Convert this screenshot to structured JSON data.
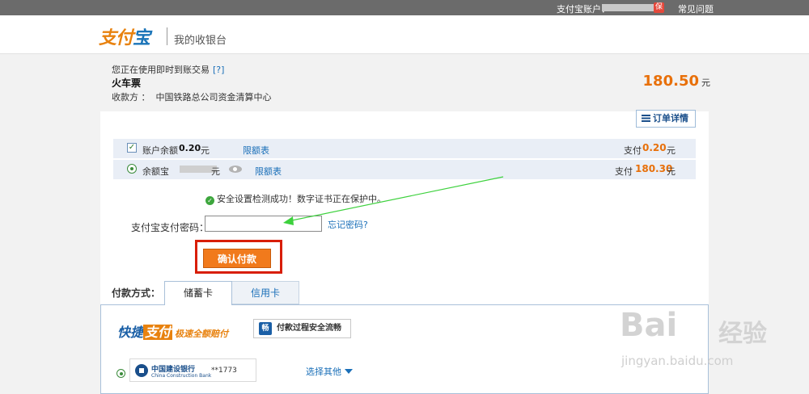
{
  "topbar": {
    "account_label": "支付宝账户：",
    "badge": "保",
    "faq": "常见问题"
  },
  "header": {
    "logo_text_a": "支付",
    "logo_text_b": "宝",
    "cashier_title": "我的收银台"
  },
  "order": {
    "notice": "您正在使用即时到账交易",
    "help": "[?]",
    "product": "火车票",
    "payee_label": "收款方 ：",
    "payee": "中国铁路总公司资金清算中心",
    "amount": "180.50",
    "amount_unit": "元",
    "detail_button": "订单详情"
  },
  "payment_rows": [
    {
      "name": "账户余额",
      "balance": "0.20",
      "unit": "元",
      "limit_link": "限额表",
      "pay_label": "支付",
      "pay_value": "0.20",
      "pay_unit": "元",
      "checked": true
    },
    {
      "name": "余额宝",
      "unit": "元",
      "limit_link": "限额表",
      "pay_label": "支付",
      "pay_value": "180.30",
      "pay_unit": "元"
    }
  ],
  "security": {
    "message": "安全设置检测成功！数字证书正在保护中。"
  },
  "password": {
    "label": "支付宝支付密码：",
    "forgot_link": "忘记密码?"
  },
  "confirm_button": "确认付款",
  "payment_method": {
    "label": "付款方式：",
    "tabs": [
      {
        "label": "储蓄卡",
        "active": true
      },
      {
        "label": "信用卡",
        "active": false
      }
    ]
  },
  "quick_pay": {
    "brand_a": "快捷",
    "brand_b": "支付",
    "slogan": "极速全额赔付",
    "safe_badge": "付款过程安全流畅",
    "shield_char": "畅"
  },
  "bank": {
    "name": "中国建设银行",
    "name_en": "China Construction Bank",
    "card_tail": "**1773",
    "select_other": "选择其他"
  },
  "watermark": {
    "main": "Bai",
    "cn": "经验",
    "url": "jingyan.baidu.com"
  },
  "colors": {
    "accent_orange": "#f17a1c",
    "link_blue": "#1a6fb8",
    "highlight_red": "#d81e06",
    "arrow_green": "#3dd13d"
  }
}
